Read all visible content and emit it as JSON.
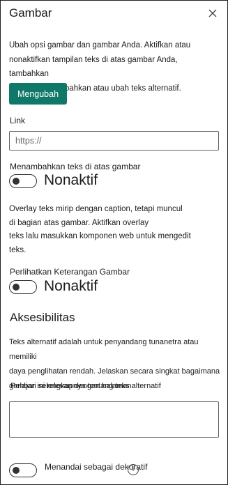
{
  "header": {
    "title": "Gambar",
    "close_icon": "close-icon"
  },
  "intro": {
    "line1": "Ubah opsi gambar dan gambar Anda. Aktifkan atau",
    "line2": "nonaktifkan tampilan teks di atas gambar Anda, tambahkan",
    "line3": "tautan, dan tambahkan atau ubah teks alternatif."
  },
  "change_button": {
    "label": "Mengubah"
  },
  "link": {
    "label": "Link",
    "placeholder": "https://",
    "value": ""
  },
  "text_overlay": {
    "label": "Menambahkan teks di atas gambar",
    "state": "Nonaktif",
    "on": false,
    "help_line1": "Overlay teks mirip dengan caption, tetapi muncul",
    "help_line2": "di bagian atas gambar. Aktifkan overlay",
    "help_line3": "teks lalu masukkan komponen web untuk mengedit",
    "help_line4": "teks."
  },
  "caption": {
    "label": "Perlihatkan Keterangan Gambar",
    "state": "Nonaktif",
    "on": false
  },
  "accessibility": {
    "title": "Aksesibilitas",
    "desc_line1": "Teks alternatif adalah untuk penyandang tunanetra atau memiliki",
    "desc_line2": "daya penglihatan rendah. Jelaskan secara singkat bagaimana",
    "desc_line3": "gambar ini relevan dengan halaman.",
    "learn_more": "Pelajari selengkapnya tentang teks alternatif",
    "alt_text_value": ""
  },
  "decorative": {
    "label": "Menandai sebagai dekoratif",
    "on": false,
    "info_icon": "info-icon",
    "info_glyph": "i"
  },
  "colors": {
    "primary": "#107868",
    "text": "#1b1b1b",
    "border": "#606060"
  }
}
